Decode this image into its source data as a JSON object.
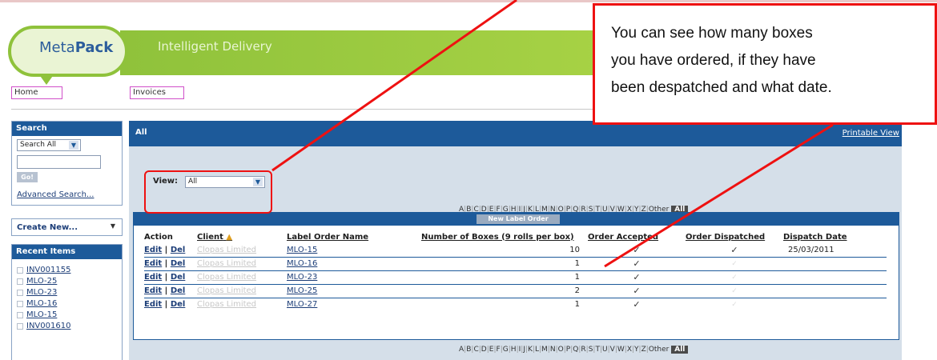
{
  "banner": {
    "logo_prefix": "Meta",
    "logo_suffix": "Pack",
    "tagline": "Intelligent Delivery"
  },
  "nav": {
    "home": "Home",
    "invoices": "Invoices"
  },
  "search": {
    "title": "Search",
    "scope": "Search All",
    "go": "Go!",
    "advanced": "Advanced Search..."
  },
  "create": {
    "label": "Create New..."
  },
  "recent": {
    "title": "Recent Items",
    "items": [
      "INV001155",
      "MLO-25",
      "MLO-23",
      "MLO-16",
      "MLO-15",
      "INV001610"
    ]
  },
  "main": {
    "title": "All",
    "printable": "Printable View",
    "view_label": "View:",
    "view_value": "All",
    "alphabet": [
      "A",
      "B",
      "C",
      "D",
      "E",
      "F",
      "G",
      "H",
      "I",
      "J",
      "K",
      "L",
      "M",
      "N",
      "O",
      "P",
      "Q",
      "R",
      "S",
      "T",
      "U",
      "V",
      "W",
      "X",
      "Y",
      "Z"
    ],
    "other": "Other",
    "all": "All",
    "new_order": "New Label Order"
  },
  "table": {
    "headers": {
      "action": "Action",
      "client": "Client",
      "name": "Label Order Name",
      "boxes": "Number of Boxes (9 rolls per box)",
      "accepted": "Order Accepted",
      "dispatched": "Order Dispatched",
      "date": "Dispatch Date"
    },
    "edit": "Edit",
    "del": "Del",
    "client_name": "Clopas Limited",
    "rows": [
      {
        "name": "MLO-15",
        "boxes": "10",
        "accepted": "✓",
        "dispatched": "✓",
        "date": "25/03/2011"
      },
      {
        "name": "MLO-16",
        "boxes": "1",
        "accepted": "✓",
        "dispatched": "",
        "date": ""
      },
      {
        "name": "MLO-23",
        "boxes": "1",
        "accepted": "✓",
        "dispatched": "",
        "date": ""
      },
      {
        "name": "MLO-25",
        "boxes": "2",
        "accepted": "✓",
        "dispatched": "",
        "date": ""
      },
      {
        "name": "MLO-27",
        "boxes": "1",
        "accepted": "✓",
        "dispatched": "",
        "date": ""
      }
    ]
  },
  "callout": {
    "lines": [
      "You can see how many boxes",
      "you have ordered, if they have",
      "been despatched and what date."
    ]
  },
  "colors": {
    "accent": "#1d5a9a",
    "brand_green": "#8fc23b",
    "annotation": "#ee1111"
  }
}
